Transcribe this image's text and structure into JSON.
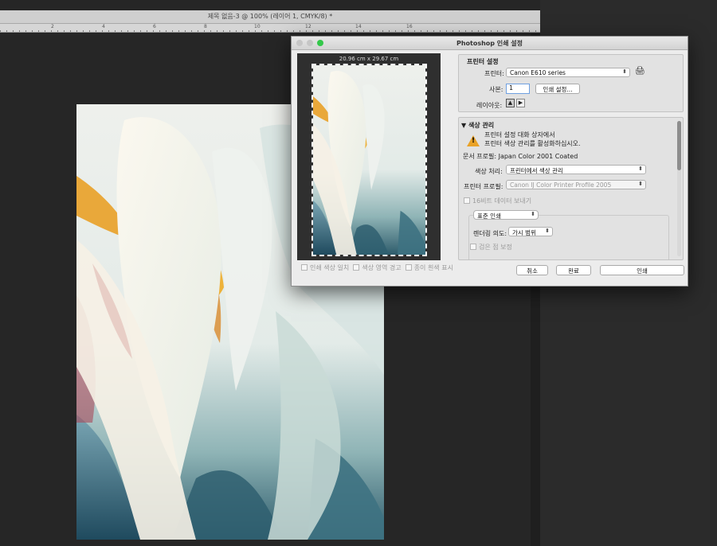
{
  "document": {
    "title": "제목 없음-3 @ 100% (레이어 1, CMYK/8) *",
    "ruler_labels": [
      "2",
      "4",
      "6",
      "8",
      "10",
      "12",
      "14",
      "16"
    ]
  },
  "dialog": {
    "title": "Photoshop 인쇄 설정",
    "preview": {
      "dimensions": "20.96 cm x 29.67 cm"
    },
    "preview_options": {
      "match_print_colors": "인쇄 색상 일치",
      "gamut_warning": "색상 영역 경고",
      "show_paper_white": "종이 흰색 표시"
    },
    "printer_setup": {
      "header": "프린터 설정",
      "printer_label": "프린터:",
      "printer_value": "Canon E610 series",
      "copies_label": "사본:",
      "copies_value": "1",
      "print_settings_button": "인쇄 설정...",
      "layout_label": "레이아웃:"
    },
    "color_management": {
      "header": "색상 관리",
      "warning_line1": "프린터 설정 대화 상자에서",
      "warning_line2": "프린터 색상 관리를 활성화하십시오.",
      "document_profile": "문서 프로필: Japan Color 2001 Coated",
      "color_handling_label": "색상 처리:",
      "color_handling_value": "프린터에서 색상 관리",
      "printer_profile_label": "프린터 프로필:",
      "printer_profile_value": "Canon IJ Color Printer Profile 2005",
      "send_16bit": "16비트 데이터 보내기",
      "normal_print": "표준 인쇄",
      "rendering_intent_label": "렌더링 의도:",
      "rendering_intent_value": "가시 범위",
      "black_point": "검은 점 보정"
    },
    "buttons": {
      "cancel": "취소",
      "done": "완료",
      "print": "인쇄"
    }
  },
  "colors": {
    "close": "#fc605b",
    "minimize": "#fdbc40",
    "zoom": "#34c84a",
    "warning": "#e9a227"
  }
}
